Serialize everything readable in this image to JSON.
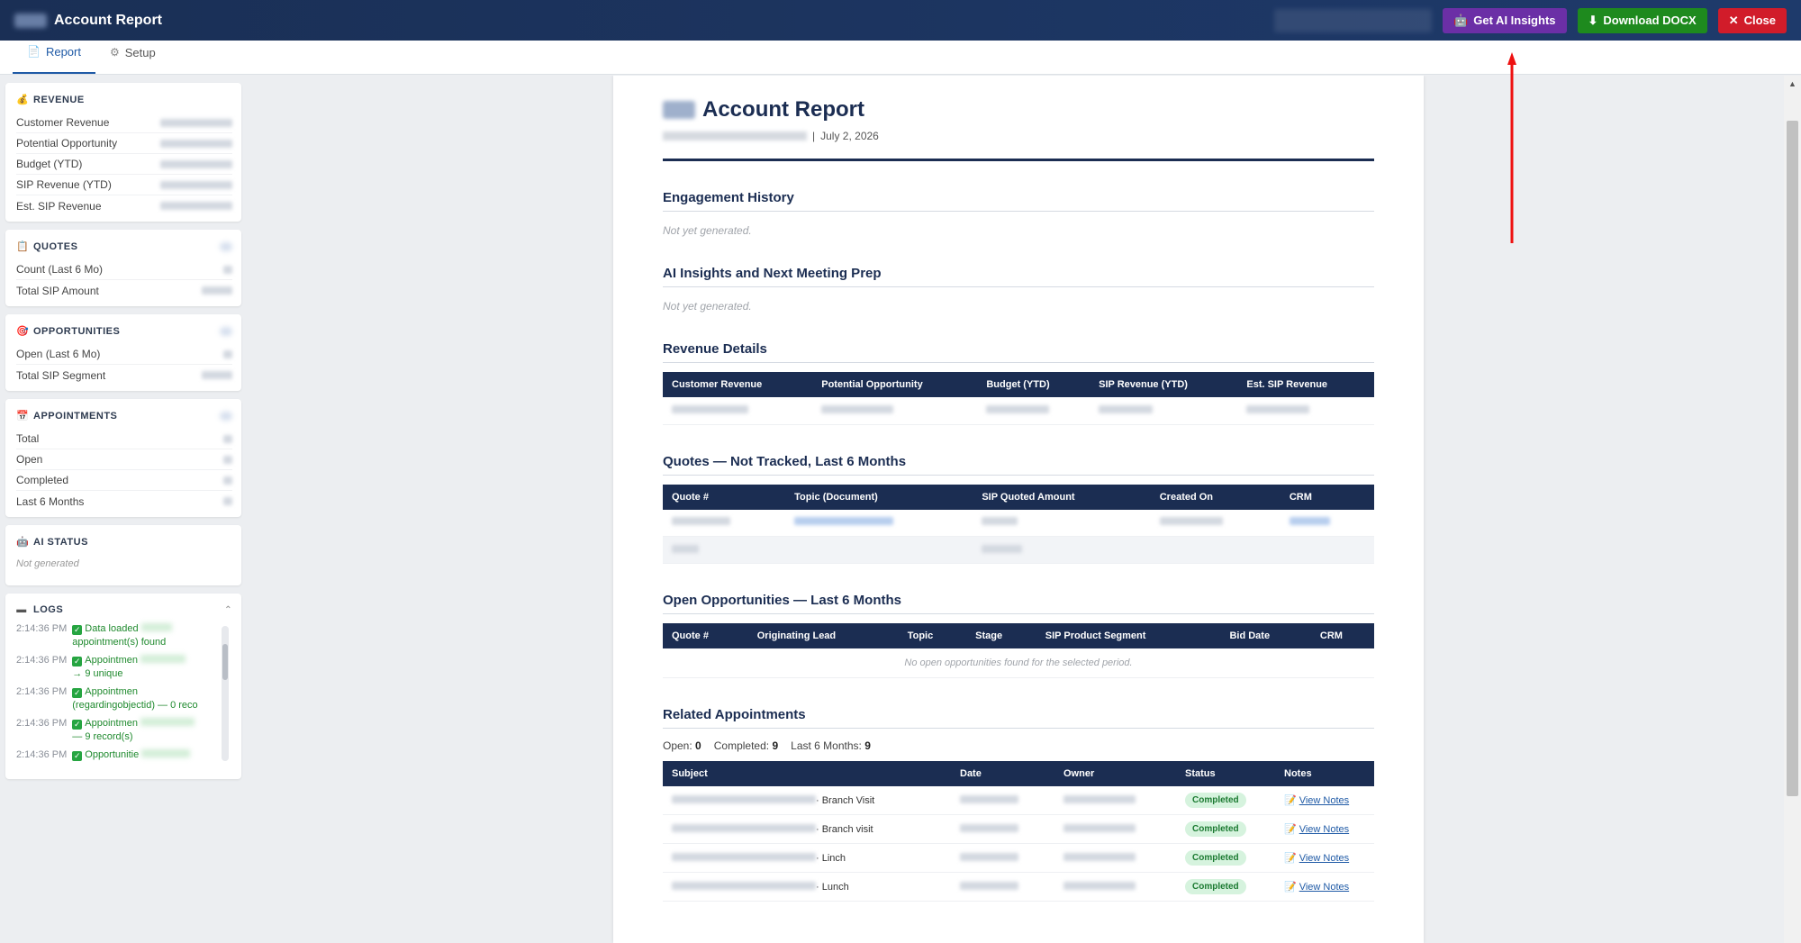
{
  "header": {
    "title": "Account Report",
    "buttons": {
      "ai": "Get AI Insights",
      "download": "Download DOCX",
      "close": "Close"
    },
    "ai_icon": "robot-icon",
    "download_icon": "download-arrow-icon",
    "close_icon": "close-x-icon"
  },
  "tabs": [
    {
      "label": "Report",
      "icon": "document-icon",
      "active": true
    },
    {
      "label": "Setup",
      "icon": "gear-icon",
      "active": false
    }
  ],
  "sidebar": {
    "revenue": {
      "title": "REVENUE",
      "icon": "money-bag-icon",
      "rows": [
        "Customer Revenue",
        "Potential Opportunity",
        "Budget (YTD)",
        "SIP Revenue (YTD)",
        "Est. SIP Revenue"
      ]
    },
    "quotes": {
      "title": "QUOTES",
      "icon": "clipboard-icon",
      "rows": [
        "Count (Last 6 Mo)",
        "Total SIP Amount"
      ]
    },
    "opportunities": {
      "title": "OPPORTUNITIES",
      "icon": "target-icon",
      "rows": [
        "Open (Last 6 Mo)",
        "Total SIP Segment"
      ]
    },
    "appointments": {
      "title": "APPOINTMENTS",
      "icon": "calendar-icon",
      "rows": [
        "Total",
        "Open",
        "Completed",
        "Last 6 Months"
      ]
    },
    "ai_status": {
      "title": "AI STATUS",
      "icon": "robot-icon",
      "value": "Not generated"
    },
    "logs": {
      "title": "LOGS",
      "icon": "folder-icon",
      "entries": [
        {
          "time": "2:14:36 PM",
          "text": "Data loaded",
          "cont": "appointment(s) found"
        },
        {
          "time": "2:14:36 PM",
          "text": "Appointmen",
          "cont": "→ 9 unique"
        },
        {
          "time": "2:14:36 PM",
          "text": "Appointmen",
          "cont": "(regardingobjectid) — 0 reco"
        },
        {
          "time": "2:14:36 PM",
          "text": "Appointmen",
          "cont": "— 9 record(s)"
        },
        {
          "time": "2:14:36 PM",
          "text": "Opportunitie",
          "cont": ""
        }
      ]
    }
  },
  "document": {
    "title": "Account Report",
    "date": "July 2, 2026",
    "date_sep": "|",
    "sections": {
      "engagement": {
        "title": "Engagement History",
        "empty": "Not yet generated."
      },
      "ai": {
        "title": "AI Insights and Next Meeting Prep",
        "empty": "Not yet generated."
      },
      "revenue": {
        "title": "Revenue Details",
        "columns": [
          "Customer Revenue",
          "Potential Opportunity",
          "Budget (YTD)",
          "SIP Revenue (YTD)",
          "Est. SIP Revenue"
        ]
      },
      "quotes": {
        "title": "Quotes — Not Tracked, Last 6 Months",
        "columns": [
          "Quote #",
          "Topic (Document)",
          "SIP Quoted Amount",
          "Created On",
          "CRM"
        ]
      },
      "opportunities": {
        "title": "Open Opportunities — Last 6 Months",
        "columns": [
          "Quote #",
          "Originating Lead",
          "Topic",
          "Stage",
          "SIP Product Segment",
          "Bid Date",
          "CRM"
        ],
        "empty": "No open opportunities found for the selected period."
      },
      "appointments": {
        "title": "Related Appointments",
        "counts": {
          "open_label": "Open:",
          "open": "0",
          "completed_label": "Completed:",
          "completed": "9",
          "last6_label": "Last 6 Months:",
          "last6": "9"
        },
        "columns": [
          "Subject",
          "Date",
          "Owner",
          "Status",
          "Notes"
        ],
        "rows": [
          {
            "subject": "· Branch Visit",
            "status": "Completed",
            "notes": "View Notes"
          },
          {
            "subject": "· Branch visit",
            "status": "Completed",
            "notes": "View Notes"
          },
          {
            "subject": "· Linch",
            "status": "Completed",
            "notes": "View Notes"
          },
          {
            "subject": "· Lunch",
            "status": "Completed",
            "notes": "View Notes"
          }
        ]
      }
    }
  },
  "colors": {
    "header_bg": "#1e3a6b",
    "ai_button": "#6b2fa6",
    "download_button": "#1e8a1e",
    "close_button": "#d11c2a",
    "table_header": "#1b2d52",
    "annotation_arrow": "#ee1111"
  }
}
